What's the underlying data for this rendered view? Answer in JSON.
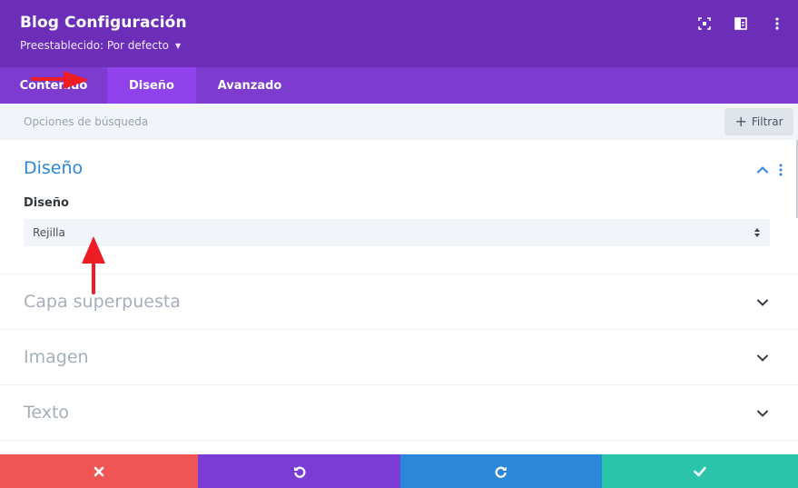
{
  "header": {
    "title": "Blog Configuración",
    "preset_label": "Preestablecido: Por defecto",
    "icons": [
      "focus-icon",
      "split-view-icon",
      "more-vertical-icon"
    ]
  },
  "tabs": [
    {
      "label": "Contenido",
      "active": false
    },
    {
      "label": "Diseño",
      "active": true
    },
    {
      "label": "Avanzado",
      "active": false
    }
  ],
  "search": {
    "placeholder": "Opciones de búsqueda",
    "filter_label": "Filtrar"
  },
  "open_section": {
    "title": "Diseño",
    "field_label": "Diseño",
    "select_value": "Rejilla"
  },
  "sections": [
    {
      "title": "Capa superpuesta"
    },
    {
      "title": "Imagen"
    },
    {
      "title": "Texto"
    }
  ],
  "footer": {
    "buttons": [
      "close-icon",
      "undo-icon",
      "redo-icon",
      "check-icon"
    ]
  },
  "colors": {
    "header_bg": "#6c2eb9",
    "tabs_bg": "#7e3bd0",
    "active_tab": "#8f42ec",
    "accent_blue": "#2b87da",
    "cancel": "#ef5555",
    "undo": "#7b3cd6",
    "redo": "#2b87da",
    "save": "#29c4a9",
    "annotation_arrow": "#ee1c25"
  }
}
